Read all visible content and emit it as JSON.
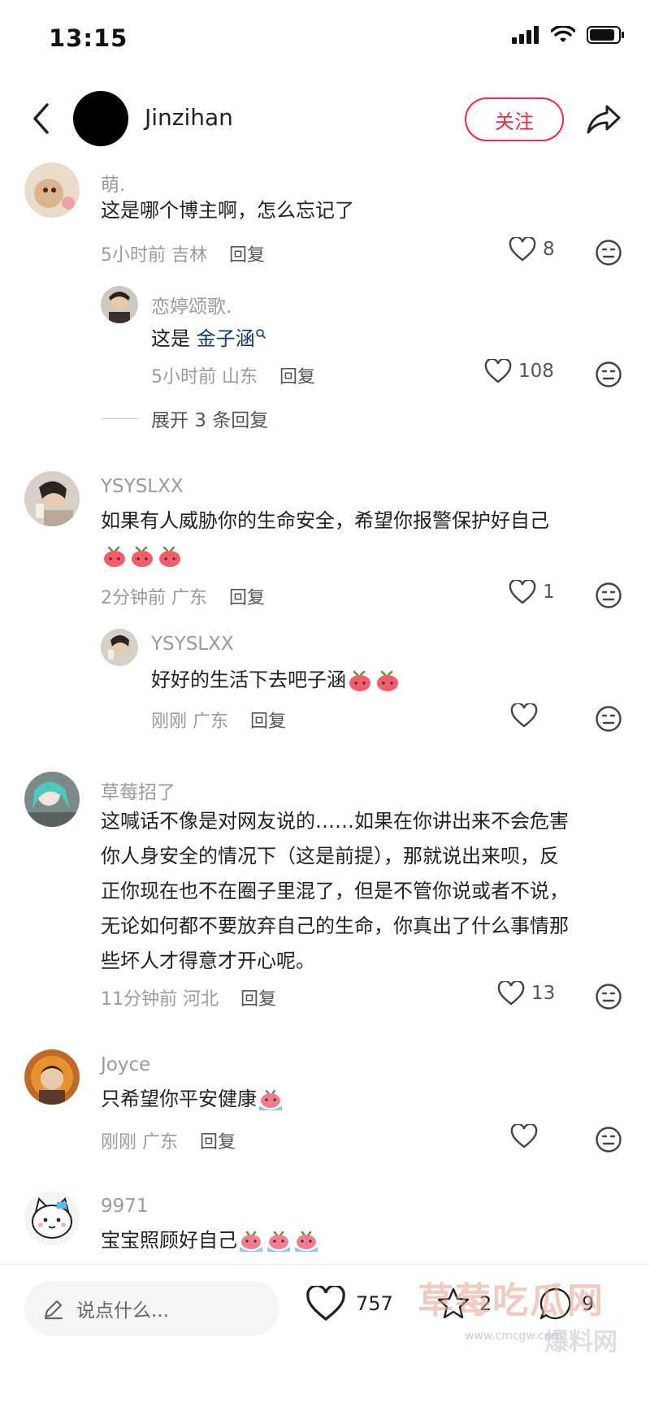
{
  "status_bar": {
    "time": "13:15"
  },
  "header": {
    "user_name": "Jinzihan",
    "follow_label": "关注"
  },
  "comments": [
    {
      "name": "萌.",
      "text": "这是哪个博主啊，怎么忘记了",
      "time": "5小时前",
      "location": "吉林",
      "reply_label": "回复",
      "likes": "8",
      "replies": [
        {
          "name": "恋婷颂歌.",
          "text_prefix": "这是",
          "mention": "金子涵",
          "time": "5小时前",
          "location": "山东",
          "reply_label": "回复",
          "likes": "108"
        }
      ],
      "expand_label": "展开 3 条回复"
    },
    {
      "name": "YSYSLXX",
      "text": "如果有人威胁你的生命安全，希望你报警保护好自己",
      "time": "2分钟前",
      "location": "广东",
      "reply_label": "回复",
      "likes": "1",
      "replies": [
        {
          "name": "YSYSLXX",
          "text": "好好的生活下去吧子涵",
          "time": "刚刚",
          "location": "广东",
          "reply_label": "回复",
          "likes": ""
        }
      ]
    },
    {
      "name": "草莓招了",
      "text_lines": [
        "这喊话不像是对网友说的……如果在你讲出来不会危害",
        "你人身安全的情况下（这是前提），那就说出来呗，反",
        "正你现在也不在圈子里混了，但是不管你说或者不说，",
        "无论如何都不要放弃自己的生命，你真出了什么事情那",
        "些坏人才得意才开心呢。"
      ],
      "time": "11分钟前",
      "location": "河北",
      "reply_label": "回复",
      "likes": "13"
    },
    {
      "name": "Joyce",
      "text": "只希望你平安健康",
      "time": "刚刚",
      "location": "广东",
      "reply_label": "回复",
      "likes": ""
    },
    {
      "name": "9971",
      "text": "宝宝照顾好自己"
    }
  ],
  "bottom_bar": {
    "input_placeholder": "说点什么...",
    "likes": "757",
    "collects": "2",
    "comments": "9"
  },
  "watermark": {
    "main": "草莓吃瓜网",
    "url": "www.cmcgw.com",
    "sub": "爆料网"
  },
  "colors": {
    "accent": "#ff2442",
    "mention": "#13386c",
    "muted": "#9a9a9a"
  }
}
